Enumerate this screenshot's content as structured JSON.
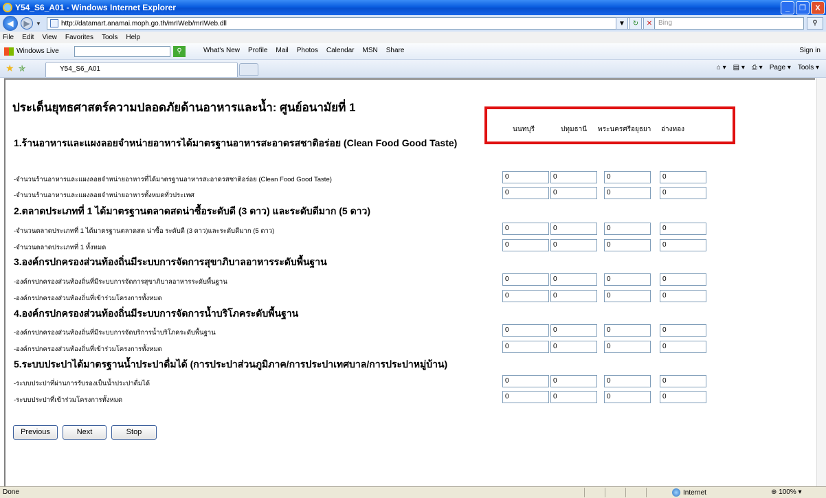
{
  "window": {
    "title": "Y54_S6_A01 - Windows Internet Explorer",
    "minimize": "_",
    "restore": "❐",
    "close": "X"
  },
  "address": {
    "url": "http://datamart.anamai.moph.go.th/mrIWeb/mrIWeb.dll",
    "search_placeholder": "Bing"
  },
  "menu": [
    "File",
    "Edit",
    "View",
    "Favorites",
    "Tools",
    "Help"
  ],
  "live": {
    "brand": "Windows Live",
    "links": [
      "What's New",
      "Profile",
      "Mail",
      "Photos",
      "Calendar",
      "MSN",
      "Share"
    ],
    "sign_in": "Sign in"
  },
  "tab": {
    "label": "Y54_S6_A01"
  },
  "command_bar": {
    "page": "Page ▾",
    "tools": "Tools ▾"
  },
  "page": {
    "title": "ประเด็นยุทธศาสตร์ความปลอดภัยด้านอาหารและน้ำ: ศูนย์อนามัยที่ 1",
    "columns": [
      "นนทบุรี",
      "ปทุมธานี",
      "พระนครศรีอยุธยา",
      "อ่างทอง"
    ],
    "sections": [
      {
        "heading": "1.ร้านอาหารและแผงลอยจำหน่ายอาหารได้มาตรฐานอาหารสะอาดรสชาติอร่อย (Clean Food Good Taste)",
        "rows": [
          {
            "label": "-จำนวนร้านอาหารและแผงลอยจำหน่ายอาหารที่ได้มาตรฐานอาหารสะอาดรสชาติอร่อย (Clean Food Good Taste)",
            "values": [
              "0",
              "0",
              "0",
              "0"
            ]
          },
          {
            "label": "-จำนวนร้านอาหารและแผงลอยจำหน่ายอาหารทั้งหมดทั่วประเทศ",
            "values": [
              "0",
              "0",
              "0",
              "0"
            ]
          }
        ]
      },
      {
        "heading": "2.ตลาดประเภทที่ 1 ได้มาตรฐานตลาดสดน่าซื้อระดับดี (3 ดาว) และระดับดีมาก (5 ดาว)",
        "rows": [
          {
            "label": "-จำนวนตลาดประเภทที่ 1 ได้มาตรฐานตลาดสด น่าซื้อ ระดับดี (3 ดาว)และระดับดีมาก (5 ดาว)",
            "values": [
              "0",
              "0",
              "0",
              "0"
            ]
          },
          {
            "label": "-จำนวนตลาดประเภทที่ 1 ทั้งหมด",
            "values": [
              "0",
              "0",
              "0",
              "0"
            ]
          }
        ]
      },
      {
        "heading": "3.องค์กรปกครองส่วนท้องถิ่นมีระบบการจัดการสุขาภิบาลอาหารระดับพื้นฐาน",
        "rows": [
          {
            "label": "-องค์กรปกครองส่วนท้องถิ่นที่มีระบบการจัดการสุขาภิบาลอาหารระดับพื้นฐาน",
            "values": [
              "0",
              "0",
              "0",
              "0"
            ]
          },
          {
            "label": "-องค์กรปกครองส่วนท้องถิ่นที่เข้าร่วมโครงการทั้งหมด",
            "values": [
              "0",
              "0",
              "0",
              "0"
            ]
          }
        ]
      },
      {
        "heading": "4.องค์กรปกครองส่วนท้องถิ่นมีระบบการจัดการน้ำบริโภคระดับพื้นฐาน",
        "rows": [
          {
            "label": "-องค์กรปกครองส่วนท้องถิ่นที่มีระบบการจัดบริการน้ำบริโภคระดับพื้นฐาน",
            "values": [
              "0",
              "0",
              "0",
              "0"
            ]
          },
          {
            "label": "-องค์กรปกครองส่วนท้องถิ่นที่เข้าร่วมโครงการทั้งหมด",
            "values": [
              "0",
              "0",
              "0",
              "0"
            ]
          }
        ]
      },
      {
        "heading": "5.ระบบประปาได้มาตรฐานน้ำประปาดื่มได้ (การประปาส่วนภูมิภาค/การประปาเทศบาล/การประปาหมู่บ้าน)",
        "rows": [
          {
            "label": "-ระบบประปาที่ผ่านการรับรองเป็นน้ำประปาดื่มได้",
            "values": [
              "0",
              "0",
              "0",
              "0"
            ]
          },
          {
            "label": "-ระบบประปาที่เข้าร่วมโครงการทั้งหมด",
            "values": [
              "0",
              "0",
              "0",
              "0"
            ]
          }
        ]
      }
    ],
    "buttons": {
      "previous": "Previous",
      "next": "Next",
      "stop": "Stop"
    }
  },
  "status": {
    "text": "Done",
    "zone": "Internet",
    "zoom": "100%"
  },
  "colors": {
    "highlight_box": "#e01010",
    "titlebar": "#0a5ee0"
  }
}
